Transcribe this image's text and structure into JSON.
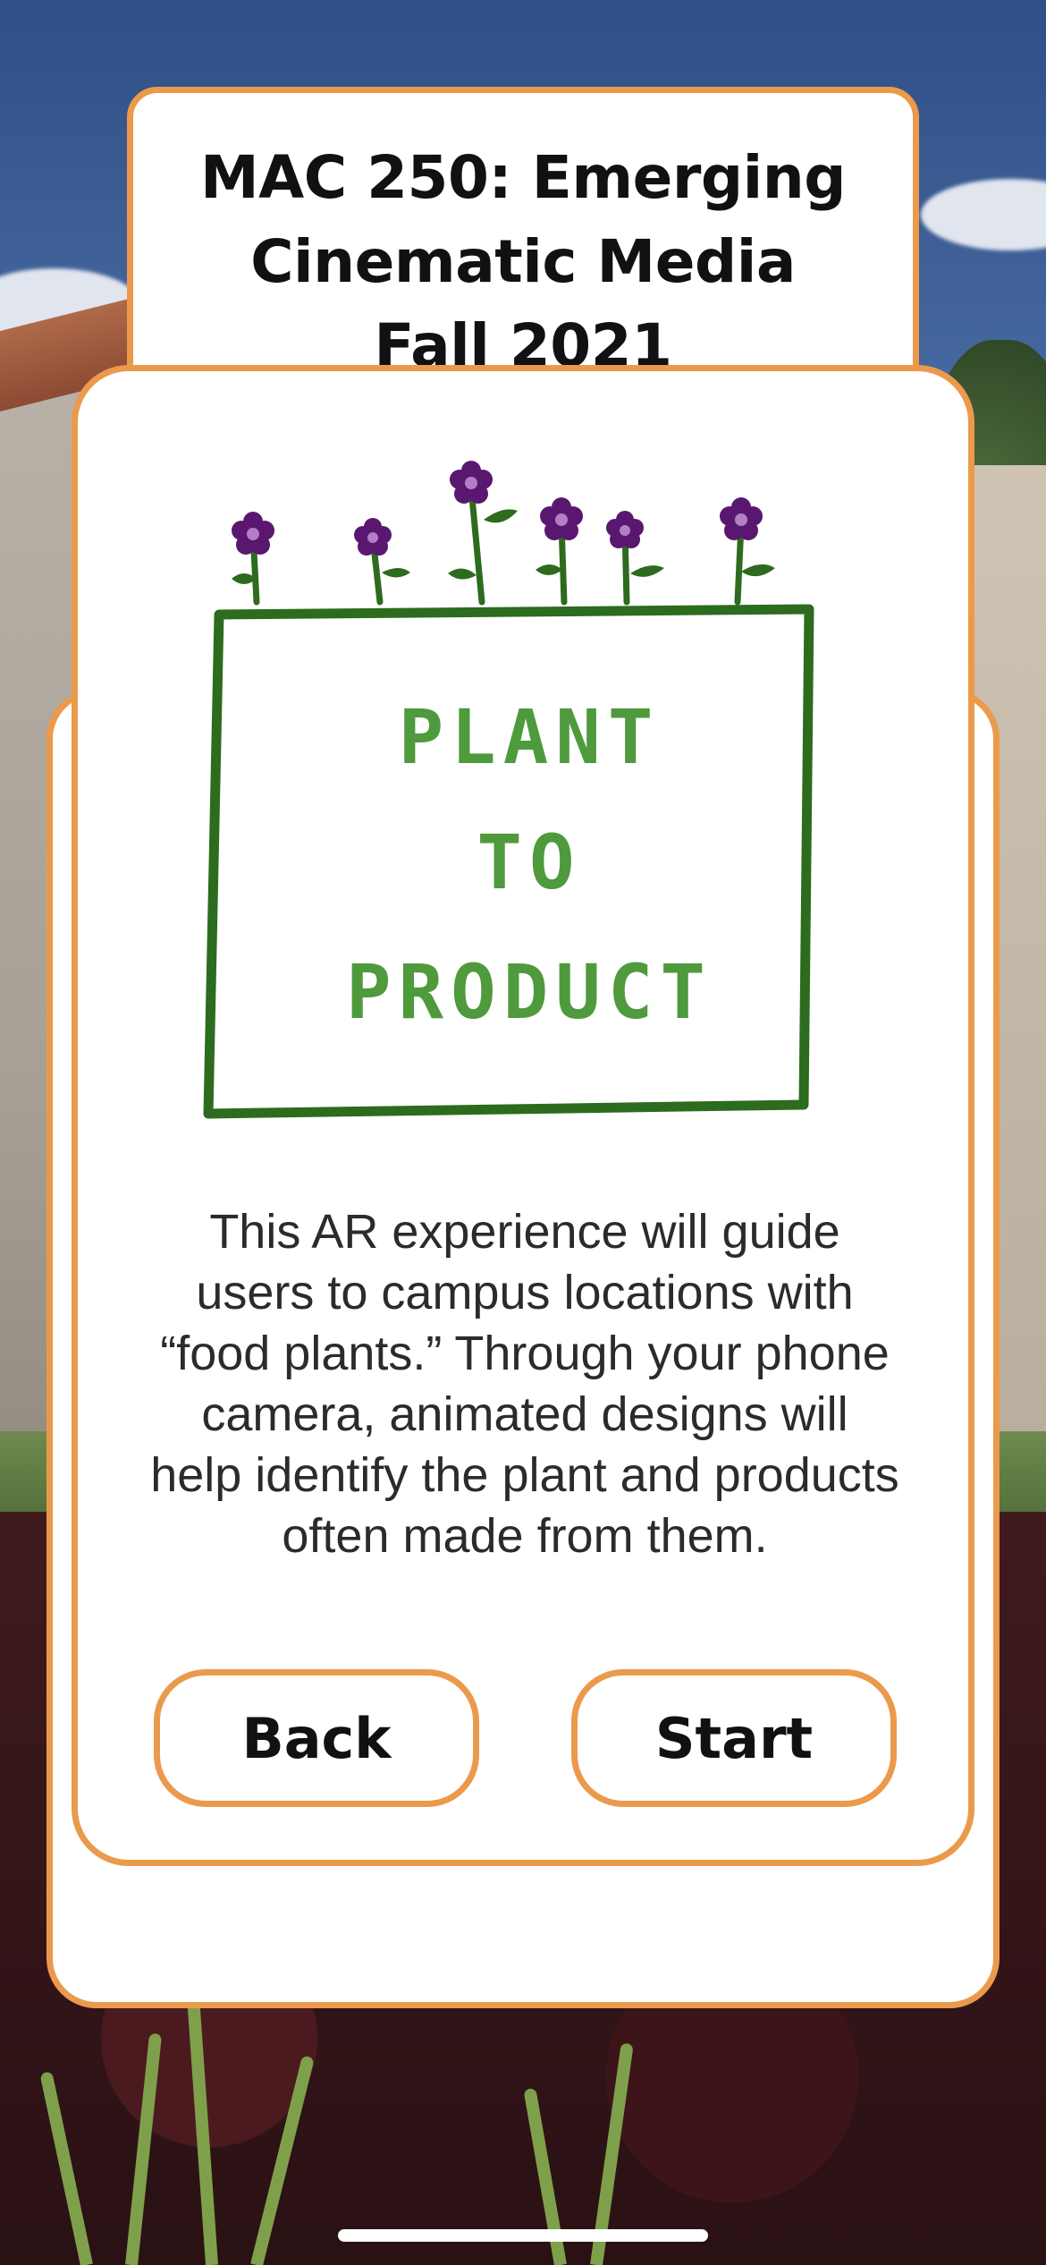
{
  "course": {
    "line1": "MAC 250: Emerging",
    "line2": "Cinematic Media",
    "line3": "Fall 2021"
  },
  "logo": {
    "line1": "PLANT",
    "line2": "TO",
    "line3": "PRODUCT",
    "frame_color": "#2d6b1f",
    "text_color": "#4e9a3c",
    "flower_color": "#5a1770"
  },
  "description": "This AR experience will guide users to campus locations with “food plants.” Through your phone camera, animated designs will help identify the plant and products often made from them.",
  "buttons": {
    "back_label": "Back",
    "start_label": "Start"
  },
  "colors": {
    "accent": "#eb9a4c",
    "card_bg": "#ffffff"
  }
}
